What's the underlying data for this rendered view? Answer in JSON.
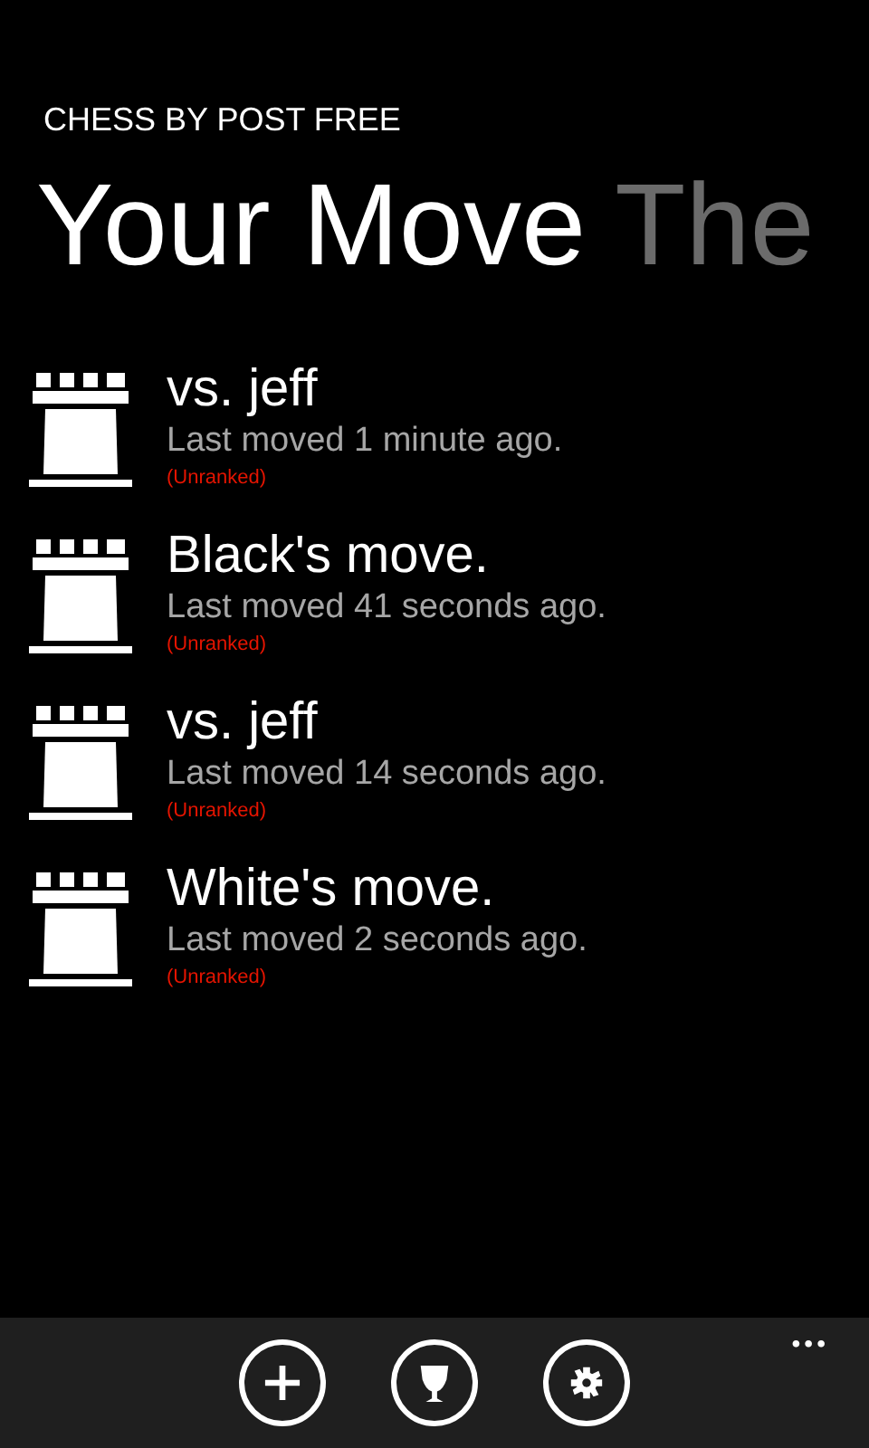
{
  "app_title": "CHESS BY POST FREE",
  "pivots": [
    {
      "label": "Your Move",
      "selected": true
    },
    {
      "label": "The",
      "selected": false
    }
  ],
  "games": [
    {
      "title": "vs. jeff",
      "subtitle": "Last moved 1 minute ago.",
      "rank": "(Unranked)"
    },
    {
      "title": "Black's move.",
      "subtitle": "Last moved 41 seconds ago.",
      "rank": "(Unranked)"
    },
    {
      "title": "vs. jeff",
      "subtitle": "Last moved 14 seconds ago.",
      "rank": "(Unranked)"
    },
    {
      "title": "White's move.",
      "subtitle": "Last moved 2 seconds ago.",
      "rank": "(Unranked)"
    }
  ],
  "app_bar": {
    "buttons": [
      {
        "kind": "add"
      },
      {
        "kind": "trophy"
      },
      {
        "kind": "settings"
      }
    ],
    "more": "•••"
  }
}
